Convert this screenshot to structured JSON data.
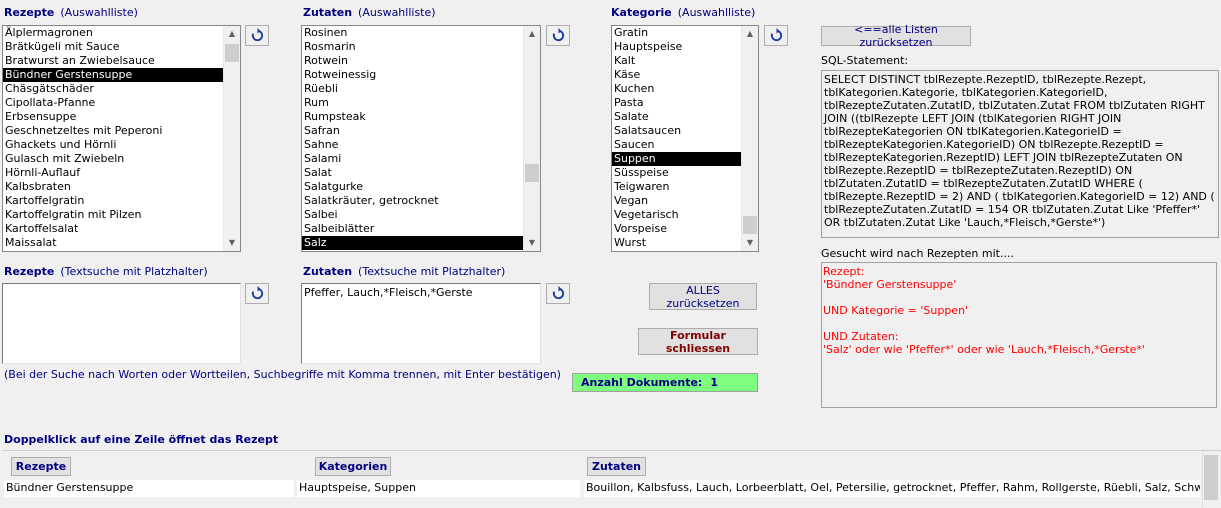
{
  "rezepte_list": {
    "label": "Rezepte",
    "sublabel": "(Auswahlliste)",
    "items": [
      "Älplermagronen",
      "Brätkügeli mit Sauce",
      "Bratwurst an Zwiebelsauce",
      "Bündner Gerstensuppe",
      "Chäsgätschäder",
      "Cipollata-Pfanne",
      "Erbsensuppe",
      "Geschnetzeltes mit Peperoni",
      "Ghackets und Hörnli",
      "Gulasch mit Zwiebeln",
      "Hörnli-Auflauf",
      "Kalbsbraten",
      "Kartoffelgratin",
      "Kartoffelgratin mit Pilzen",
      "Kartoffelsalat",
      "Maissalat"
    ],
    "selected": "Bündner Gerstensuppe"
  },
  "zutaten_list": {
    "label": "Zutaten",
    "sublabel": "(Auswahlliste)",
    "items": [
      "Rosinen",
      "Rosmarin",
      "Rotwein",
      "Rotweinessig",
      "Rüebli",
      "Rum",
      "Rumpsteak",
      "Safran",
      "Sahne",
      "Salami",
      "Salat",
      "Salatgurke",
      "Salatkräuter, getrocknet",
      "Salbei",
      "Salbeiblätter",
      "Salz"
    ],
    "selected": "Salz"
  },
  "kategorie_list": {
    "label": "Kategorie",
    "sublabel": "(Auswahlliste)",
    "items": [
      "Gratin",
      "Hauptspeise",
      "Kalt",
      "Käse",
      "Kuchen",
      "Pasta",
      "Salate",
      "Salatsaucen",
      "Saucen",
      "Suppen",
      "Süsspeise",
      "Teigwaren",
      "Vegan",
      "Vegetarisch",
      "Vorspeise",
      "Wurst"
    ],
    "selected": "Suppen"
  },
  "rezepte_search": {
    "label": "Rezepte",
    "sublabel": "(Textsuche mit Platzhalter)",
    "value": ""
  },
  "zutaten_search": {
    "label": "Zutaten",
    "sublabel": "(Textsuche mit Platzhalter)",
    "value": "Pfeffer, Lauch,*Fleisch,*Gerste"
  },
  "hint_text": "(Bei der Suche nach Worten oder Wortteilen, Suchbegriffe mit Komma trennen, mit Enter bestätigen)",
  "buttons": {
    "reset_lists": "<==alle Listen zurücksetzen",
    "reset_all": "ALLES zurücksetzen",
    "close_form": "Formular schliessen"
  },
  "count": {
    "label": "Anzahl Dokumente:",
    "value": "1"
  },
  "sql": {
    "label": "SQL-Statement:",
    "text": "SELECT DISTINCT tblRezepte.RezeptID, tblRezepte.Rezept, tblKategorien.Kategorie, tblKategorien.KategorieID, tblRezepteZutaten.ZutatID, tblZutaten.Zutat FROM tblZutaten RIGHT JOIN ((tblRezepte LEFT JOIN (tblKategorien RIGHT JOIN tblRezepteKategorien  ON tblKategorien.KategorieID = tblRezepteKategorien.KategorieID) ON tblRezepte.RezeptID = tblRezepteKategorien.RezeptID)  LEFT JOIN tblRezepteZutaten ON tblRezepte.RezeptID = tblRezepteZutaten.RezeptID) ON tblZutaten.ZutatID = tblRezepteZutaten.ZutatID  WHERE ( tblRezepte.RezeptID = 2) AND ( tblKategorien.KategorieID = 12) AND ( tblRezepteZutaten.ZutatID = 154 OR tblZutaten.Zutat Like 'Pfeffer*' OR tblZutaten.Zutat Like 'Lauch,*Fleisch,*Gerste*')"
  },
  "search_result": {
    "label": "Gesucht wird nach Rezepten mit....",
    "lines": [
      "Rezept:",
      "'Bündner Gerstensuppe'",
      "",
      "UND Kategorie = 'Suppen'",
      "",
      "UND Zutaten:",
      "'Salz' oder wie 'Pfeffer*' oder wie 'Lauch,*Fleisch,*Gerste*'"
    ]
  },
  "grid": {
    "caption": "Doppelklick auf eine Zeile öffnet das Rezept",
    "headers": [
      "Rezepte",
      "Kategorien",
      "Zutaten"
    ],
    "rows": [
      [
        "Bündner Gerstensuppe",
        "Hauptspeise, Suppen",
        "Bouillon, Kalbsfuss, Lauch, Lorbeerblatt, Oel, Petersilie, getrocknet, Pfeffer, Rahm, Rollgerste, Rüebli, Salz, Schweinefleisch,"
      ]
    ]
  },
  "icons": {
    "refresh": "refresh-icon",
    "scroll_up": "chevron-up-icon",
    "scroll_down": "chevron-down-icon"
  }
}
